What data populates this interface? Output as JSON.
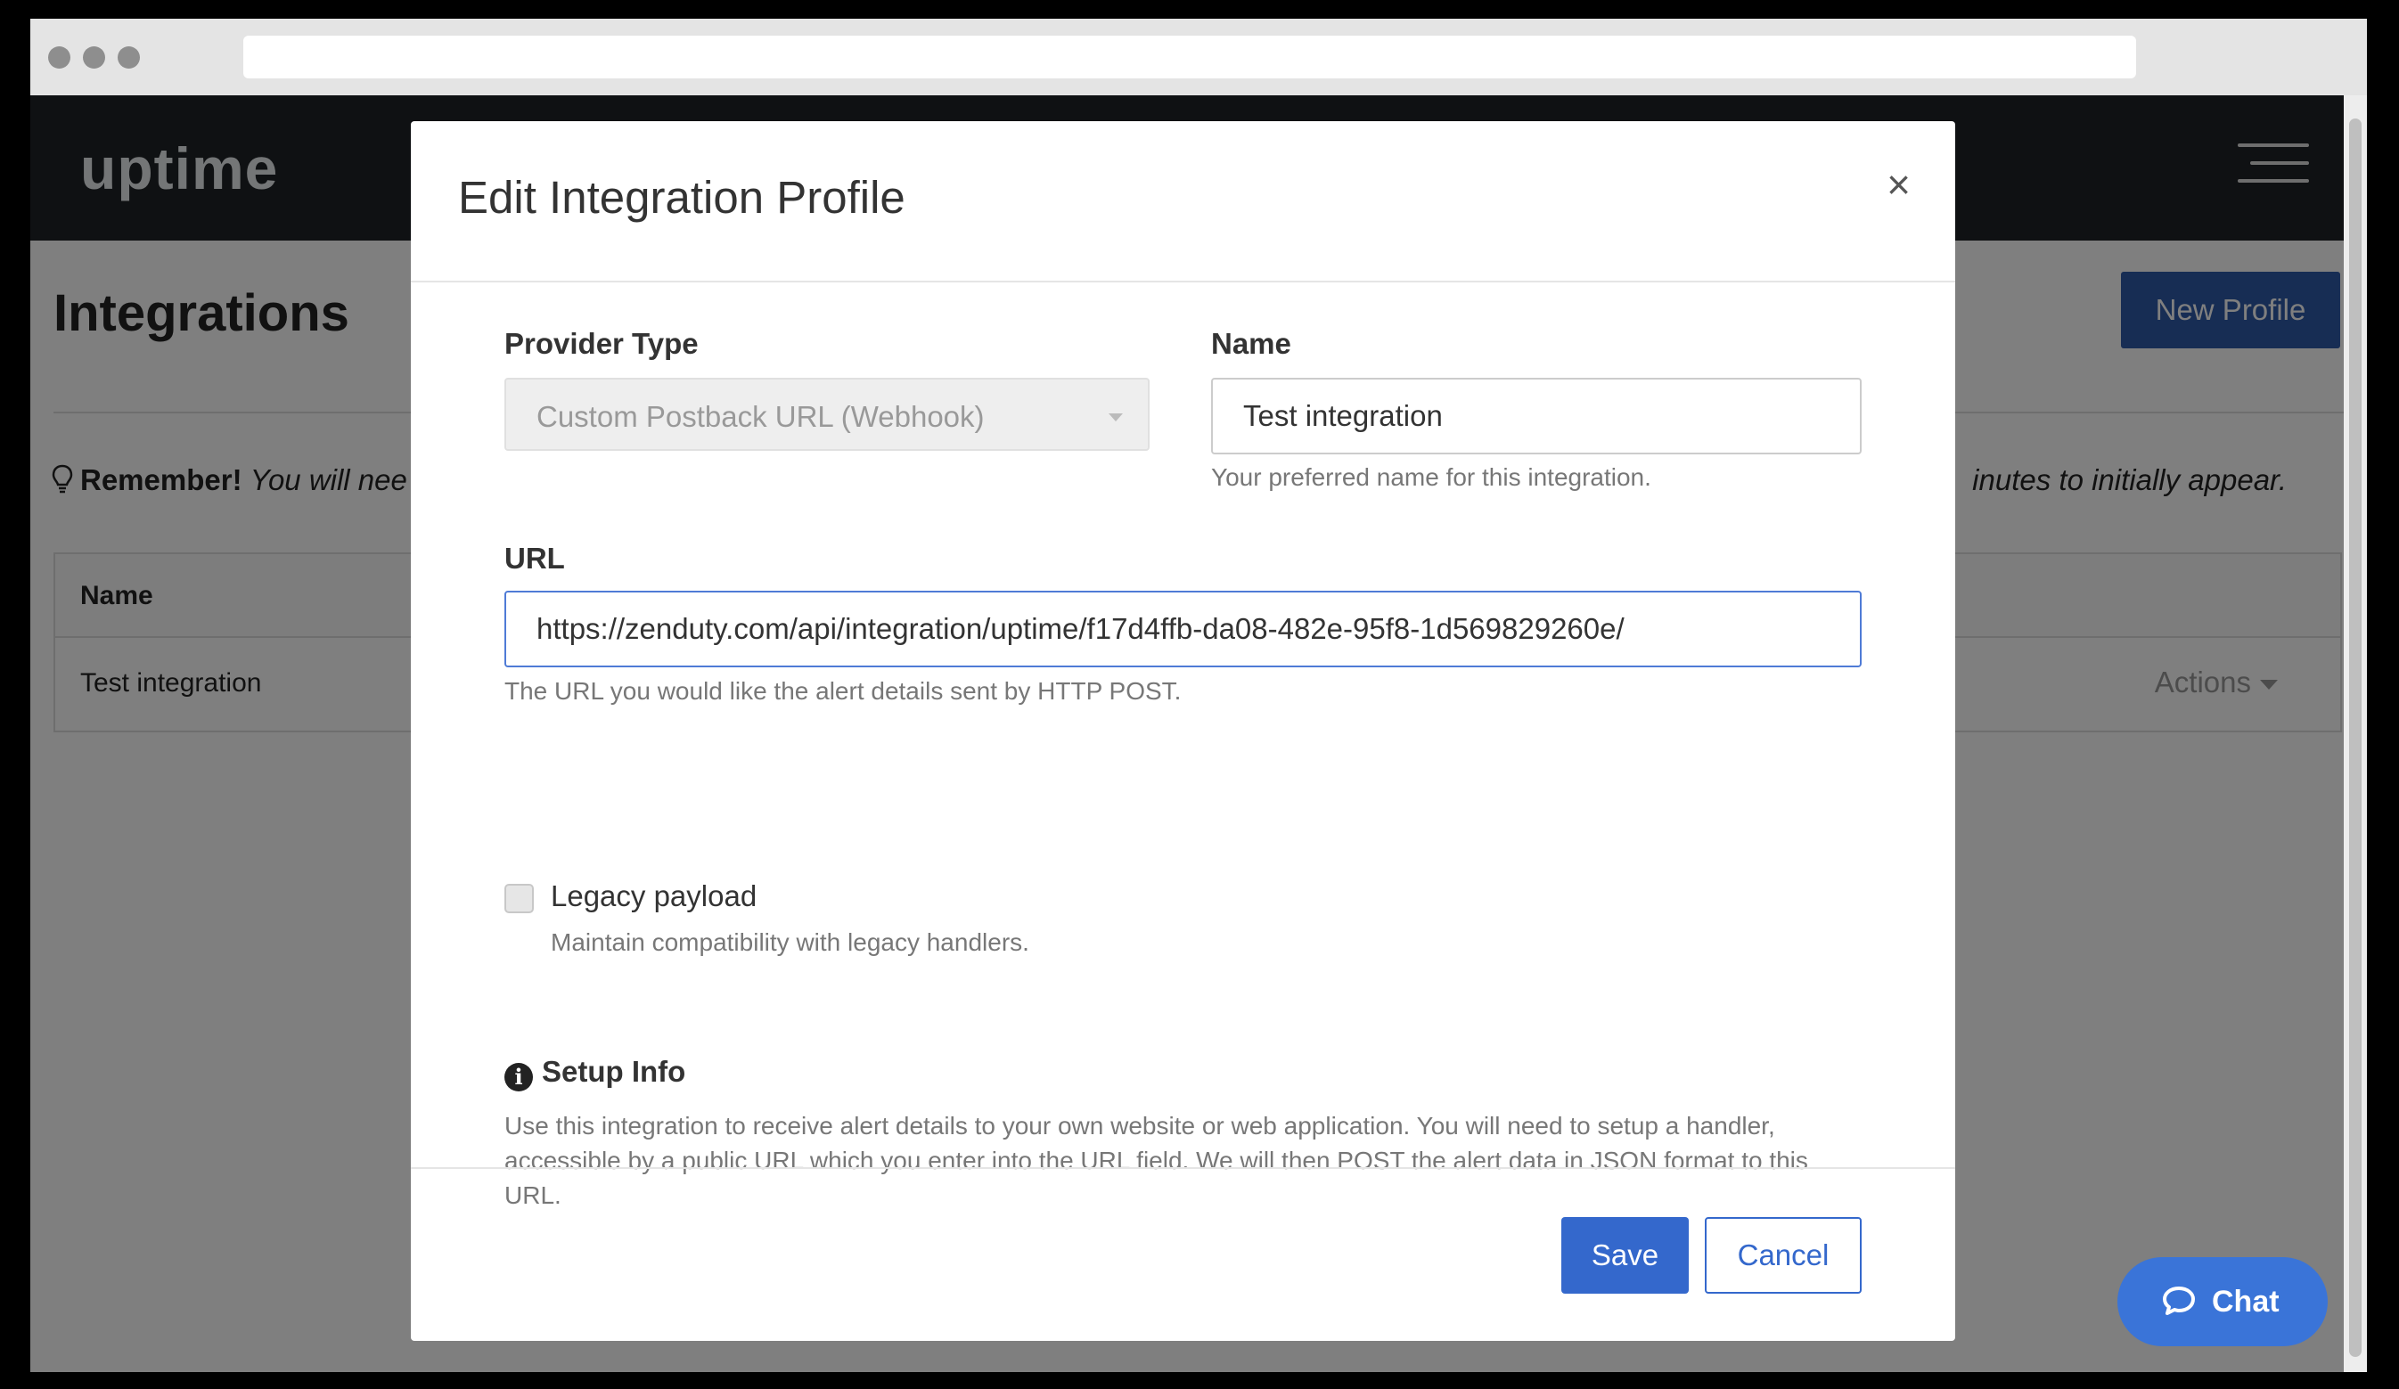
{
  "app": {
    "logo": "uptime"
  },
  "page": {
    "title": "Integrations",
    "new_profile_label": "New Profile",
    "remember_bold": "Remember!",
    "remember_italic_left": "You will nee",
    "remember_italic_right": "inutes to initially appear."
  },
  "table": {
    "header_name": "Name",
    "rows": [
      {
        "name": "Test integration",
        "actions": "Actions"
      }
    ]
  },
  "modal": {
    "title": "Edit Integration Profile",
    "close_symbol": "×",
    "provider_type_label": "Provider Type",
    "provider_type_value": "Custom Postback URL (Webhook)",
    "name_label": "Name",
    "name_value": "Test integration",
    "name_help": "Your preferred name for this integration.",
    "url_label": "URL",
    "url_value": "https://zenduty.com/api/integration/uptime/f17d4ffb-da08-482e-95f8-1d569829260e/",
    "url_help": "The URL you would like the alert details sent by HTTP POST.",
    "legacy_label": "Legacy payload",
    "legacy_checked": false,
    "legacy_help": "Maintain compatibility with legacy handlers.",
    "setup_title": "Setup Info",
    "setup_text": "Use this integration to receive alert details to your own website or web application. You will need to setup a handler, accessible by a public URL which you enter into the URL field. We will then POST the alert data in JSON format to this URL.",
    "save_label": "Save",
    "cancel_label": "Cancel"
  },
  "chat": {
    "label": "Chat"
  },
  "icons": {
    "lightbulb": "lightbulb-icon",
    "info": "info-circle-icon",
    "close": "close-icon",
    "menu": "hamburger-menu-icon",
    "chat": "chat-bubble-icon",
    "caret": "chevron-down-icon"
  },
  "colors": {
    "primary": "#3468cc",
    "header_bg": "#1f2327",
    "new_profile_bg": "#2f5aa8",
    "chat_bg": "#3a74d8"
  }
}
